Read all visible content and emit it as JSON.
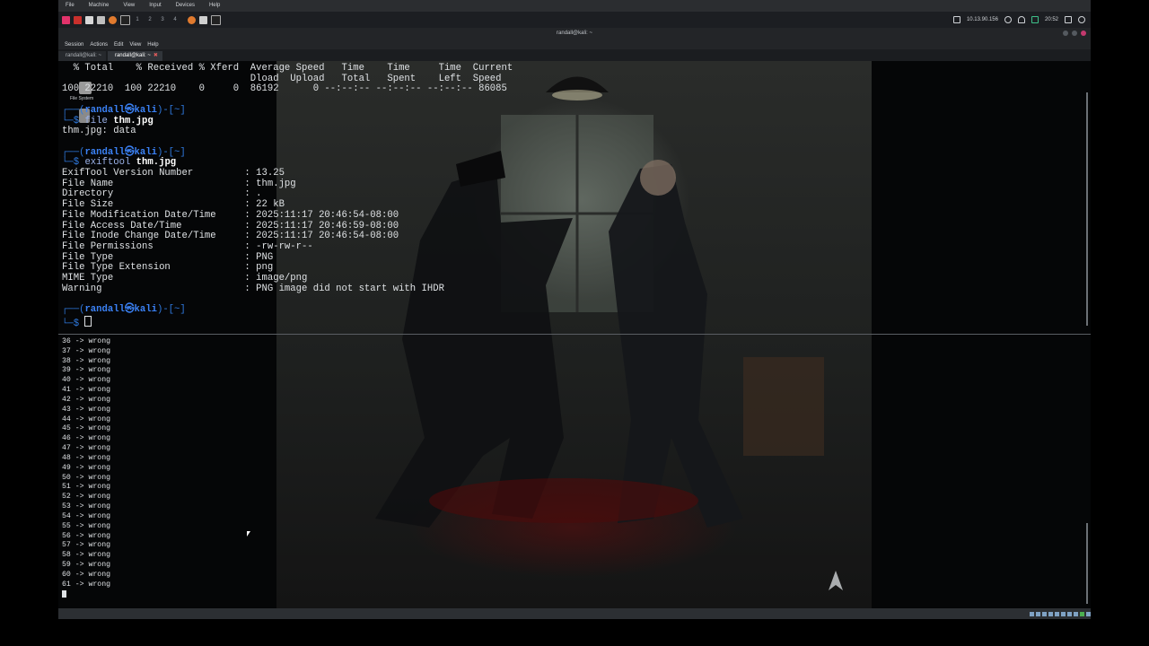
{
  "vbox_menu": [
    "File",
    "Machine",
    "View",
    "Input",
    "Devices",
    "Help"
  ],
  "panel": {
    "workspaces": [
      "1",
      "2",
      "3",
      "4"
    ],
    "ip": "10.13.90.156",
    "clock": "20:52"
  },
  "window": {
    "title": "randall@kali: ~",
    "menu": [
      "Session",
      "Actions",
      "Edit",
      "View",
      "Help"
    ],
    "tabs": [
      "randall@kali: ~",
      "randall@kali: ~"
    ]
  },
  "desktop": {
    "icon_label": "File System"
  },
  "curl": {
    "header1": "  % Total    % Received % Xferd  Average Speed   Time    Time     Time  Current",
    "header2": "                                 Dload  Upload   Total   Spent    Left  Speed",
    "row": "100 22210  100 22210    0     0  86192      0 --:--:-- --:--:-- --:--:-- 86085"
  },
  "prompt": {
    "open": "┌──(",
    "user": "randall㉿kali",
    "close": ")-[~]",
    "arrow": "└─$ "
  },
  "cmd1": {
    "name": "file",
    "arg": "thm.jpg",
    "output": "thm.jpg: data"
  },
  "cmd2": {
    "name": "exiftool",
    "arg": "thm.jpg",
    "output": [
      "ExifTool Version Number         : 13.25",
      "File Name                       : thm.jpg",
      "Directory                       : .",
      "File Size                       : 22 kB",
      "File Modification Date/Time     : 2025:11:17 20:46:54-08:00",
      "File Access Date/Time           : 2025:11:17 20:46:59-08:00",
      "File Inode Change Date/Time     : 2025:11:17 20:46:54-08:00",
      "File Permissions                : -rw-rw-r--",
      "File Type                       : PNG",
      "File Type Extension             : png",
      "MIME Type                       : image/png",
      "Warning                         : PNG image did not start with IHDR"
    ]
  },
  "bottom_lines": [
    "36 -> wrong",
    "37 -> wrong",
    "38 -> wrong",
    "39 -> wrong",
    "40 -> wrong",
    "41 -> wrong",
    "42 -> wrong",
    "43 -> wrong",
    "44 -> wrong",
    "45 -> wrong",
    "46 -> wrong",
    "47 -> wrong",
    "48 -> wrong",
    "49 -> wrong",
    "50 -> wrong",
    "51 -> wrong",
    "52 -> wrong",
    "53 -> wrong",
    "54 -> wrong",
    "55 -> wrong",
    "56 -> wrong",
    "57 -> wrong",
    "58 -> wrong",
    "59 -> wrong",
    "60 -> wrong",
    "61 -> wrong"
  ],
  "colors": {
    "prompt_frame": "#2f7ae0",
    "prompt_user": "#3b82f6",
    "terminal_text": "#dfe2e5",
    "close_accent": "#c4396e"
  }
}
